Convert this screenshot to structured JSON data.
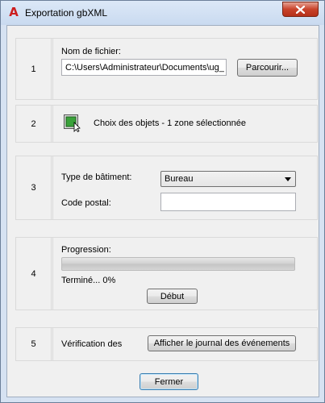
{
  "window": {
    "title": "Exportation gbXML"
  },
  "section1": {
    "number": "1",
    "filename_label": "Nom de fichier:",
    "filename_value": "C:\\Users\\Administrateur\\Documents\\ug_",
    "browse_button": "Parcourir..."
  },
  "section2": {
    "number": "2",
    "choose_objects_text": "Choix des objets - 1 zone sélectionnée"
  },
  "section3": {
    "number": "3",
    "building_type_label": "Type de bâtiment:",
    "building_type_value": "Bureau",
    "postal_code_label": "Code postal:",
    "postal_code_value": ""
  },
  "section4": {
    "number": "4",
    "progress_label": "Progression:",
    "progress_percent": 0,
    "status_text": "Terminé... 0%",
    "start_button": "Début"
  },
  "section5": {
    "number": "5",
    "verification_label": "Vérification des",
    "show_log_button": "Afficher le journal des événements"
  },
  "footer": {
    "close_button": "Fermer"
  },
  "icons": {
    "app_icon": "autocad-a-icon",
    "close_icon": "close-x-icon",
    "select_objects_icon": "select-objects-icon"
  },
  "colors": {
    "accent_red": "#cc1d1d",
    "progress_fill": "#06b025"
  }
}
